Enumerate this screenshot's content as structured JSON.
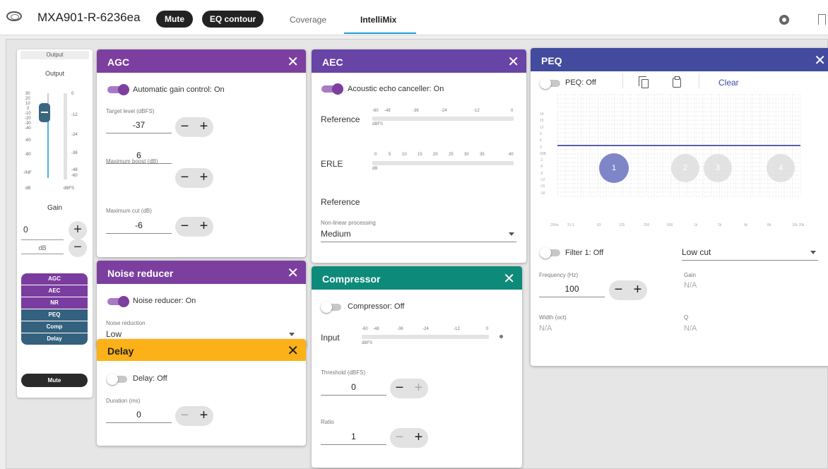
{
  "topbar": {
    "device_name": "MXA901-R-6236ea",
    "mute_label": "Mute",
    "eq_label": "EQ contour",
    "tabs": [
      {
        "label": "Coverage"
      },
      {
        "label": "IntelliMix"
      }
    ],
    "active_tab": "IntelliMix"
  },
  "output": {
    "tag": "Output",
    "title": "Output",
    "fader_scale": [
      "30",
      "20",
      "10",
      "0",
      "-10",
      "-20",
      "-30",
      "-40",
      "-60",
      "-80",
      "-INF"
    ],
    "meter_scale": [
      "0",
      "-12",
      "-24",
      "-36",
      "-48",
      "-60"
    ],
    "fader_unit": "dB",
    "meter_unit": "dBFS",
    "gain_label": "Gain",
    "gain_value": "0",
    "gain_unit": "dB",
    "blocks": [
      "AGC",
      "AEC",
      "NR",
      "PEQ",
      "Comp",
      "Delay"
    ],
    "mute_label": "Mute"
  },
  "agc": {
    "title": "AGC",
    "toggle_label": "Automatic gain control: On",
    "target_label": "Target level (dBFS)",
    "target_value": "-37",
    "boost_label": "Maximum boost (dB)",
    "boost_value": "6",
    "cut_label": "Maximum cut (dB)",
    "cut_value": "-6"
  },
  "aec": {
    "title": "AEC",
    "toggle_label": "Acoustic echo canceller: On",
    "reference_label": "Reference",
    "reference_ticks": [
      "-60",
      "-48",
      "-36",
      "-24",
      "-12",
      "0"
    ],
    "reference_unit": "dBFS",
    "erle_label": "ERLE",
    "erle_ticks": [
      "0",
      "5",
      "10",
      "15",
      "20",
      "25",
      "30",
      "35",
      "40"
    ],
    "erle_unit": "dB",
    "reference2_label": "Reference",
    "nlp_label": "Non-linear processing",
    "nlp_value": "Medium"
  },
  "nr": {
    "title": "Noise reducer",
    "toggle_label": "Noise reducer: On",
    "level_label": "Noise reduction",
    "level_value": "Low"
  },
  "delay": {
    "title": "Delay",
    "toggle_label": "Delay: Off",
    "duration_label": "Duration (ms)",
    "duration_value": "0"
  },
  "compressor": {
    "title": "Compressor",
    "toggle_label": "Compressor: Off",
    "input_label": "Input",
    "input_ticks": [
      "-60",
      "-48",
      "-36",
      "-24",
      "-12",
      "0"
    ],
    "input_unit": "dBFS",
    "threshold_label": "Threshold (dBFS)",
    "threshold_value": "0",
    "ratio_label": "Ratio",
    "ratio_value": "1"
  },
  "peq": {
    "title": "PEQ",
    "toggle_label": "PEQ: Off",
    "clear_label": "Clear",
    "y_ticks": [
      "18",
      "15",
      "12",
      "9",
      "6",
      "3",
      "0dB",
      "-3",
      "-6",
      "-9",
      "-12",
      "-15",
      "-18"
    ],
    "x_ticks": [
      "20Hz",
      "31.5",
      "63",
      "125",
      "250",
      "500",
      "1k",
      "2k",
      "4k",
      "8k",
      "16k 20k"
    ],
    "nodes": [
      "1",
      "2",
      "3",
      "4"
    ],
    "filter_toggle_label": "Filter 1: Off",
    "filter_type": "Low cut",
    "frequency_label": "Frequency (Hz)",
    "frequency_value": "100",
    "gain_label": "Gain",
    "gain_value": "N/A",
    "width_label": "Width (oct)",
    "width_value": "N/A",
    "q_label": "Q",
    "q_value": "N/A"
  },
  "colors": {
    "agc": "#7c3f9f",
    "aec": "#6744a6",
    "compressor": "#0e8a7a",
    "peq": "#424b9d",
    "delay": "#fbb117",
    "tab_underline": "#1e9bd7"
  }
}
